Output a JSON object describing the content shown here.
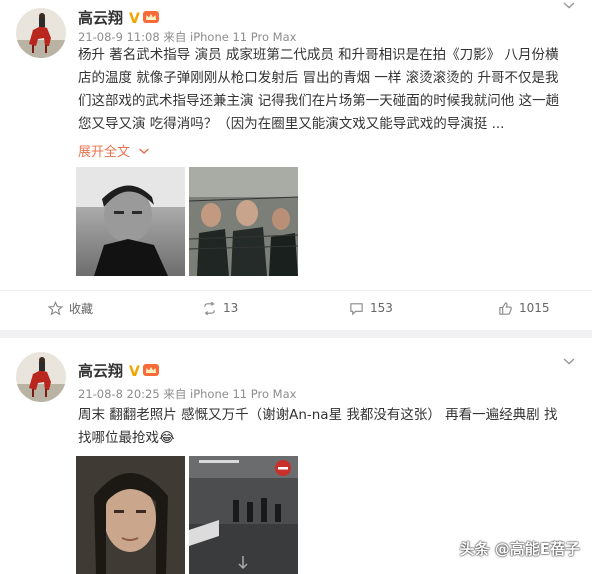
{
  "posts": [
    {
      "author": "高云翔",
      "verified_badge": "V",
      "timestamp": "21-08-9 11:08",
      "source_prefix": "来自",
      "device": "iPhone 11 Pro Max",
      "text": "杨升 著名武术指导 演员 成家班第二代成员 和升哥相识是在拍《刀影》 八月份横店的温度 就像子弹刚刚从枪口发射后 冒出的青烟 一样 滚烫滚烫的 升哥不仅是我们这部戏的武术指导还兼主演 记得我们在片场第一天碰面的时候我就问他 这一趟您又导又演 吃得消吗？（因为在圈里又能演文戏又能导武戏的导演挺 ...",
      "expand_label": "展开全文",
      "actions": {
        "favorite_label": "收藏",
        "repost_count": "13",
        "comment_count": "153",
        "like_count": "1015"
      }
    },
    {
      "author": "高云翔",
      "verified_badge": "V",
      "timestamp": "21-08-8 20:25",
      "source_prefix": "来自",
      "device": "iPhone 11 Pro Max",
      "text": "周末 翻翻老照片 感慨又万千（谢谢An-na星 我都没有这张） 再看一遍经典剧 找找哪位最抢戏😂"
    }
  ],
  "watermark": "头条 @高能E蓓子",
  "colors": {
    "accent_orange": "#eb7350",
    "verified_gold": "#f0a500",
    "meta_gray": "#8c8c8c",
    "separator": "#f2f2f5"
  },
  "icons": [
    "chevron-down-icon",
    "star-icon",
    "repost-icon",
    "comment-icon",
    "like-icon",
    "crown-icon"
  ]
}
